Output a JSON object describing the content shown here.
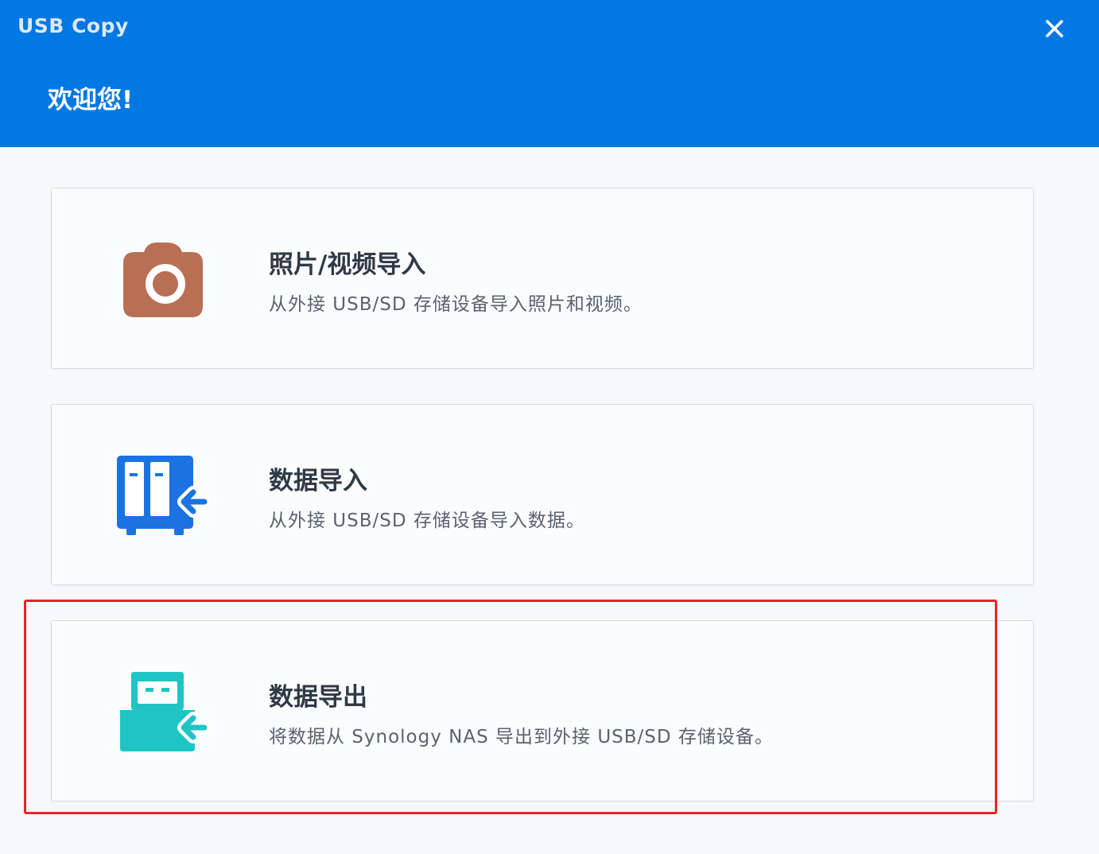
{
  "window": {
    "title": "USB Copy",
    "close_icon": "close-icon",
    "welcome": "欢迎您!"
  },
  "colors": {
    "header_bg": "#0078e2",
    "camera": "#b87055",
    "nas": "#1a73e0",
    "usb": "#20c4c4",
    "highlight": "#e5262b"
  },
  "options": [
    {
      "title": "照片/视频导入",
      "description": "从外接 USB/SD 存储设备导入照片和视频。",
      "icon": "camera-icon"
    },
    {
      "title": "数据导入",
      "description": "从外接 USB/SD 存储设备导入数据。",
      "icon": "nas-import-icon"
    },
    {
      "title": "数据导出",
      "description": "将数据从 Synology NAS 导出到外接 USB/SD 存储设备。",
      "icon": "usb-export-icon"
    }
  ]
}
